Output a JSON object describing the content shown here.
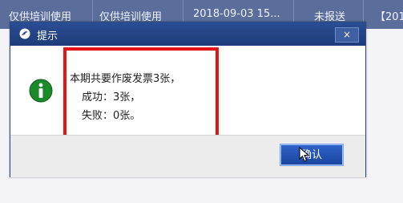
{
  "top_row": {
    "cells": [
      "仅供培训使用",
      "仅供培训使用",
      "2018-09-03 15...",
      "未报送",
      "【201"
    ]
  },
  "dialog": {
    "title": "提示",
    "close_glyph": "×",
    "message": {
      "line1": "本期共要作废发票3张，",
      "line2": "成功：3张，",
      "line3": "失败：0张。"
    },
    "ok_label": "确认"
  },
  "colors": {
    "titlebar": "#1e3c79",
    "highlight_border": "#e31515",
    "ok_button": "#1a45a0",
    "info_icon": "#1b8a2a"
  },
  "icons": {
    "title": "app-logo-icon",
    "message": "info-icon",
    "pointer": "mouse-cursor-icon"
  }
}
